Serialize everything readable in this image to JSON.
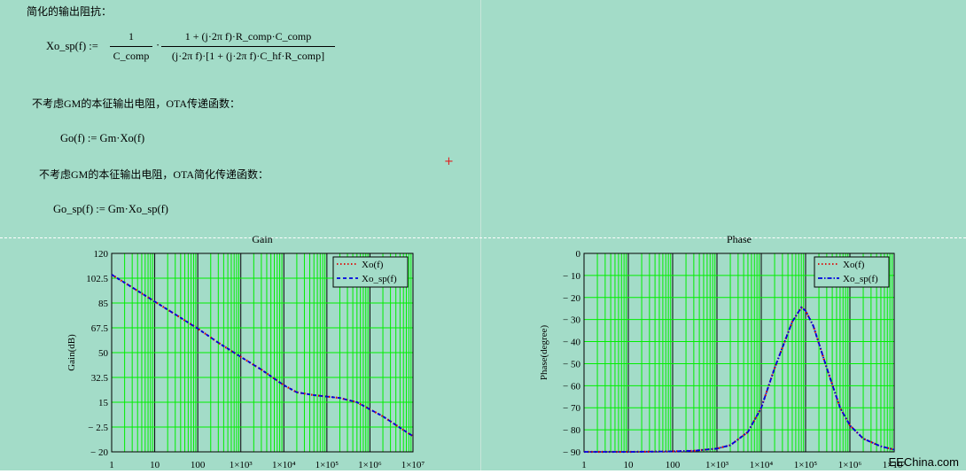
{
  "worksheet": {
    "heading": "简化的输出阻抗：",
    "eq_lhs": "Xo_sp(f) :=",
    "frac1_num": "1",
    "frac1_den": "C_comp",
    "dot": "·",
    "frac2_num": "1 + (j·2π f)·R_comp·C_comp",
    "frac2_den": "(j·2π f)·[1 + (j·2π f)·C_hf·R_comp]",
    "text2": "不考虑GM的本征输出电阻，OTA传递函数：",
    "eq2": "Go(f) := Gm·Xo(f)",
    "text3": "不考虑GM的本征输出电阻，OTA简化传递函数：",
    "eq3": "Go_sp(f) := Gm·Xo_sp(f)",
    "cursor": "+"
  },
  "watermark": "EEChina.com",
  "chart_data": [
    {
      "type": "line",
      "title": "Gain",
      "xlabel": "",
      "ylabel": "Gain(dB)",
      "x_scale": "log",
      "xlim": [
        1,
        10000000
      ],
      "ylim": [
        -20,
        120
      ],
      "yticks": [
        "120",
        "102.5",
        "85",
        "67.5",
        "50",
        "32.5",
        "15",
        "− 2.5",
        "− 20"
      ],
      "xticks": [
        "1",
        "10",
        "100",
        "1×10³",
        "1×10⁴",
        "1×10⁵",
        "1×10⁶",
        "1×10⁷"
      ],
      "grid": true,
      "legend_position": "top-right",
      "series": [
        {
          "name": "Xo(f)",
          "color": "#e00000",
          "style": "dotted",
          "x": [
            1,
            3,
            10,
            30,
            100,
            300,
            1000,
            3000,
            10000,
            20000,
            50000,
            100000,
            200000,
            500000,
            1000000,
            2000000,
            5000000,
            10000000
          ],
          "y": [
            105,
            96,
            86,
            77,
            67,
            57,
            47,
            38,
            27,
            22,
            20,
            19,
            18,
            15,
            10,
            5,
            -3,
            -9
          ]
        },
        {
          "name": "Xo_sp(f)",
          "color": "#0000e0",
          "style": "dashed",
          "x": [
            1,
            3,
            10,
            30,
            100,
            300,
            1000,
            3000,
            10000,
            20000,
            50000,
            100000,
            200000,
            500000,
            1000000,
            2000000,
            5000000,
            10000000
          ],
          "y": [
            105,
            96,
            86,
            77,
            67,
            57,
            47,
            38,
            27,
            22,
            20,
            19,
            18,
            15,
            10,
            5,
            -3,
            -9
          ]
        }
      ]
    },
    {
      "type": "line",
      "title": "Phase",
      "xlabel": "",
      "ylabel": "Phase(degree)",
      "x_scale": "log",
      "xlim": [
        1,
        10000000
      ],
      "ylim": [
        -90,
        0
      ],
      "yticks": [
        "0",
        "− 10",
        "− 20",
        "− 30",
        "− 40",
        "− 50",
        "− 60",
        "− 70",
        "− 80",
        "− 90"
      ],
      "xticks": [
        "1",
        "10",
        "100",
        "1×10³",
        "1×10⁴",
        "1×10⁵",
        "1×10⁶",
        "1×10⁷"
      ],
      "grid": true,
      "legend_position": "top-right",
      "series": [
        {
          "name": "Xo(f)",
          "color": "#e00000",
          "style": "dotted",
          "x": [
            1,
            10,
            100,
            300,
            1000,
            2000,
            5000,
            10000,
            20000,
            50000,
            80000,
            100000,
            150000,
            300000,
            600000,
            1000000,
            2000000,
            5000000,
            10000000
          ],
          "y": [
            -90,
            -90,
            -89.8,
            -89.5,
            -88.5,
            -87,
            -81,
            -70,
            -52,
            -31,
            -24.5,
            -26,
            -33,
            -52,
            -70,
            -78,
            -84,
            -87.5,
            -89
          ]
        },
        {
          "name": "Xo_sp(f)",
          "color": "#0000e0",
          "style": "dashdot",
          "x": [
            1,
            10,
            100,
            300,
            1000,
            2000,
            5000,
            10000,
            20000,
            50000,
            80000,
            100000,
            150000,
            300000,
            600000,
            1000000,
            2000000,
            5000000,
            10000000
          ],
          "y": [
            -90,
            -90,
            -89.8,
            -89.5,
            -88.5,
            -87,
            -81,
            -70,
            -52,
            -31,
            -24.5,
            -26,
            -33,
            -52,
            -70,
            -78,
            -84,
            -87.5,
            -89
          ]
        }
      ]
    }
  ]
}
